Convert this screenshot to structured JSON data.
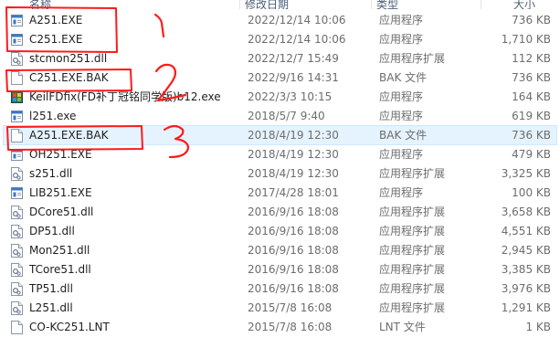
{
  "header": {
    "name": "名称",
    "date": "修改日期",
    "type": "类型",
    "size": "大小"
  },
  "colors": {
    "annotation": "#ff1a1a",
    "hover_background": "#e5f3ff",
    "hover_border": "#cce8ff"
  },
  "files": [
    {
      "name": "A251.EXE",
      "date": "2022/12/14 10:06",
      "type": "应用程序",
      "size": "736 KB",
      "icon": "exe-icon"
    },
    {
      "name": "C251.EXE",
      "date": "2022/12/14 10:06",
      "type": "应用程序",
      "size": "1,710 KB",
      "icon": "exe-icon"
    },
    {
      "name": "stcmon251.dll",
      "date": "2022/12/7 15:49",
      "type": "应用程序扩展",
      "size": "112 KB",
      "icon": "dll-icon"
    },
    {
      "name": "C251.EXE.BAK",
      "date": "2022/9/16 14:31",
      "type": "BAK 文件",
      "size": "736 KB",
      "icon": "blank-file-icon"
    },
    {
      "name": "KeilFDfix(FD补丁冠铭同学版)b12.exe",
      "date": "2022/3/3 10:15",
      "type": "应用程序",
      "size": "164 KB",
      "icon": "installer-icon"
    },
    {
      "name": "l251.exe",
      "date": "2018/5/7 9:40",
      "type": "应用程序",
      "size": "619 KB",
      "icon": "exe-icon"
    },
    {
      "name": "A251.EXE.BAK",
      "date": "2018/4/19 12:30",
      "type": "BAK 文件",
      "size": "736 KB",
      "icon": "blank-file-icon"
    },
    {
      "name": "OH251.EXE",
      "date": "2018/4/19 12:30",
      "type": "应用程序",
      "size": "479 KB",
      "icon": "exe-icon"
    },
    {
      "name": "s251.dll",
      "date": "2018/4/19 12:30",
      "type": "应用程序扩展",
      "size": "3,325 KB",
      "icon": "dll-icon"
    },
    {
      "name": "LIB251.EXE",
      "date": "2017/4/28 18:01",
      "type": "应用程序",
      "size": "100 KB",
      "icon": "exe-icon"
    },
    {
      "name": "DCore51.dll",
      "date": "2016/9/16 18:08",
      "type": "应用程序扩展",
      "size": "3,658 KB",
      "icon": "dll-icon"
    },
    {
      "name": "DP51.dll",
      "date": "2016/9/16 18:08",
      "type": "应用程序扩展",
      "size": "4,551 KB",
      "icon": "dll-icon"
    },
    {
      "name": "Mon251.dll",
      "date": "2016/9/16 18:08",
      "type": "应用程序扩展",
      "size": "2,945 KB",
      "icon": "dll-icon"
    },
    {
      "name": "TCore51.dll",
      "date": "2016/9/16 18:08",
      "type": "应用程序扩展",
      "size": "3,385 KB",
      "icon": "dll-icon"
    },
    {
      "name": "TP51.dll",
      "date": "2016/9/16 18:08",
      "type": "应用程序扩展",
      "size": "3,976 KB",
      "icon": "dll-icon"
    },
    {
      "name": "L251.dll",
      "date": "2015/7/8 16:08",
      "type": "应用程序扩展",
      "size": "1,291 KB",
      "icon": "dll-icon"
    },
    {
      "name": "CO-KC251.LNT",
      "date": "2015/7/8 16:08",
      "type": "LNT 文件",
      "size": "1 KB",
      "icon": "blank-file-icon"
    }
  ],
  "annotations": {
    "mark_1": "1",
    "mark_2": "2",
    "mark_3": "3"
  }
}
